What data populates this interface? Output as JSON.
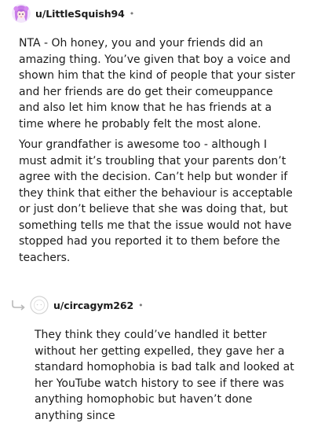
{
  "comments": [
    {
      "username": "u/LittleSquish94",
      "separator": "•",
      "paragraphs": [
        "NTA - Oh honey, you and your friends did an amazing thing. You’ve given that boy a voice and shown him that the kind of people that your sister and her friends are do get their comeuppance and also let him know that he has friends at a time where he probably felt the most alone.",
        "Your grandfather is awesome too - although I must admit it’s troubling that your parents don’t agree with the decision. Can’t help but wonder if they think that either the behaviour is acceptable or just don’t believe that she was doing that, but something tells me that the issue would not have stopped had you reported it to them before the teachers."
      ],
      "avatar_icon": "anime-girl-avatar-icon",
      "avatar_color": "#c77be8"
    },
    {
      "username": "u/circagym262",
      "separator": "•",
      "paragraphs": [
        "They think they could’ve handled it better without her getting expelled, they gave her a standard homophobia is bad talk and looked at her YouTube watch history to see if there was anything homophobic but haven’t done anything since"
      ],
      "avatar_icon": "default-outline-avatar-icon",
      "reply_icon": "reply-arrow-icon"
    }
  ]
}
